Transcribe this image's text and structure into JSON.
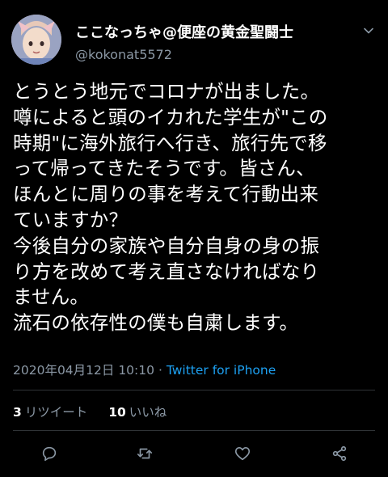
{
  "user": {
    "display_name": "ここなっちゃ@便座の黄金聖闘士",
    "handle": "@kokonat5572",
    "avatar": "avatar-photo"
  },
  "tweet": {
    "lines": [
      "とうとう地元でコロナが出ました。",
      "噂によると頭のイカれた学生が\"この",
      "時期\"に海外旅行へ行き、旅行先で移",
      "って帰ってきたそうです。皆さん、",
      "ほんとに周りの事を考えて行動出来",
      "ていますか？",
      "今後自分の家族や自分自身の身の振",
      "り方を改めて考え直さなければなり",
      "ません。",
      "流石の依存性の僕も自粛します。"
    ]
  },
  "meta": {
    "timestamp": "2020年04月12日 10:10",
    "separator": "·",
    "source": "Twitter for iPhone"
  },
  "stats": {
    "retweets_count": "3",
    "retweets_label": "リツイート",
    "likes_count": "10",
    "likes_label": "いいね"
  },
  "actions": {
    "reply": "reply-icon",
    "retweet": "retweet-icon",
    "like": "heart-icon",
    "share": "share-icon"
  },
  "colors": {
    "background": "#000000",
    "text": "#ffffff",
    "secondary": "#8b98a5",
    "link": "#1da1f2",
    "divider": "#2f3336"
  }
}
